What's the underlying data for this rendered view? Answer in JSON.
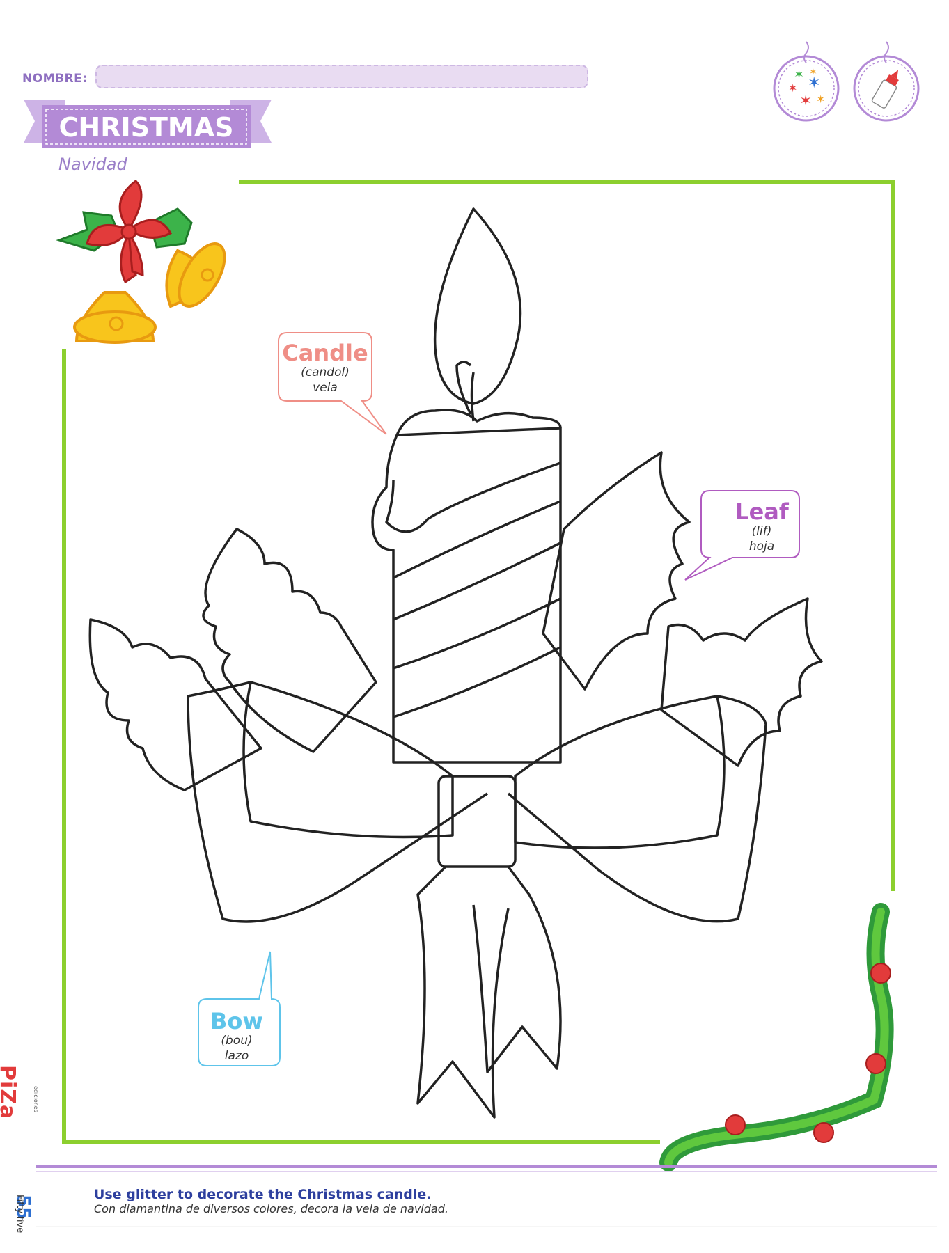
{
  "header": {
    "name_label": "NOMBRE:",
    "title": "CHRISTMAS",
    "subtitle": "Navidad"
  },
  "labels": {
    "candle": {
      "word": "Candle",
      "pron": "(candol)",
      "trans": "vela"
    },
    "leaf": {
      "word": "Leaf",
      "pron": "(lif)",
      "trans": "hoja"
    },
    "bow": {
      "word": "Bow",
      "pron": "(bou)",
      "trans": "lazo"
    }
  },
  "footer": {
    "instruction_en": "Use glitter to decorate the Christmas candle.",
    "instruction_es": "Con diamantina de diversos colores, decora la vela de navidad.",
    "page_number": "55",
    "page_word": "Fifty five",
    "publisher": "PiZa",
    "publisher_sub": "ediciones"
  },
  "colors": {
    "accent_purple": "#b38ad6",
    "frame_green": "#8ccf2e",
    "candle_label": "#ef8e86",
    "leaf_label": "#b05bc0",
    "bow_label": "#5ec4ea"
  },
  "icons": [
    "glitter-ornament-icon",
    "glue-bottle-ornament-icon",
    "bells-icon",
    "holly-corner-icon"
  ]
}
